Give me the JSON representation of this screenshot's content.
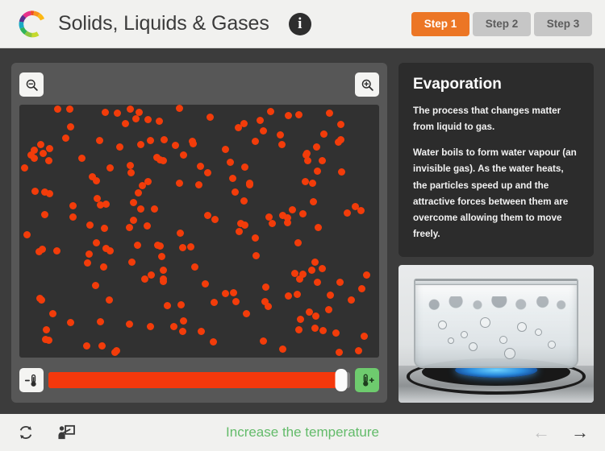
{
  "header": {
    "logo_icon": "colorful-c-logo",
    "title": "Solids, Liquids & Gases",
    "info_icon": "info-icon",
    "info_glyph": "i",
    "steps": [
      {
        "label": "Step 1",
        "active": true
      },
      {
        "label": "Step 2",
        "active": false
      },
      {
        "label": "Step 3",
        "active": false
      }
    ],
    "active_step_color": "#ec7625",
    "inactive_step_color": "#c6c6c6"
  },
  "simulation": {
    "zoom_out_icon": "zoom-out-icon",
    "zoom_in_icon": "zoom-in-icon",
    "state": "gas",
    "particle_color": "#f23c0a",
    "particle_count": 200,
    "canvas_background": "#313131",
    "temperature": {
      "decrease_icon": "thermometer-minus-icon",
      "increase_icon": "thermometer-plus-icon",
      "increase_highlighted": true,
      "increase_button_color": "#6ecb6e",
      "slider_percent": 97,
      "slider_fill_color": "#f4380c"
    }
  },
  "info_panel": {
    "heading": "Evaporation",
    "paragraphs": [
      "The process that changes matter from liquid to gas.",
      "Water boils to form water vapour (an invisible gas). As the water heats, the particles speed up and the attractive forces between them are overcome allowing them to move freely."
    ],
    "photo_caption": "boiling-water-in-glass-pot-on-gas-burner"
  },
  "footer": {
    "reset_icon": "reset-icon",
    "presenter_icon": "presenter-icon",
    "message": "Increase the temperature",
    "message_color": "#63bb6a",
    "prev_icon": "arrow-left-icon",
    "prev_glyph": "←",
    "prev_disabled": true,
    "next_icon": "arrow-right-icon",
    "next_glyph": "→",
    "next_disabled": false
  }
}
